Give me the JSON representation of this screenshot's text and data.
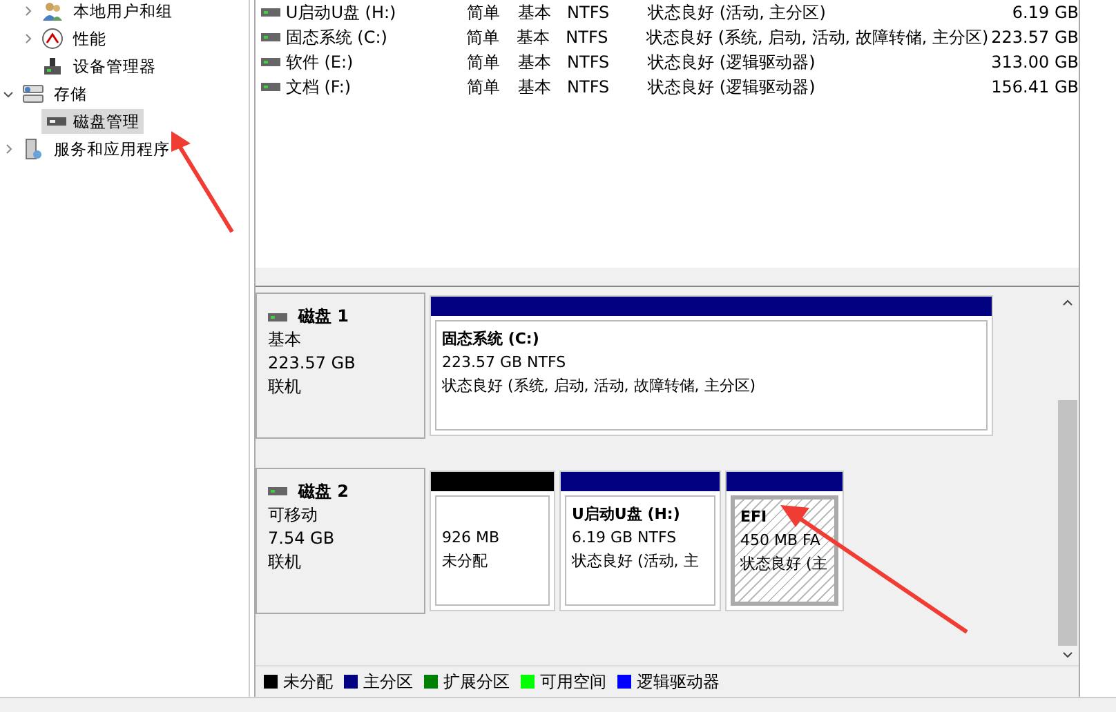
{
  "tree": {
    "items": [
      {
        "label": "本地用户和组",
        "kind": "folder",
        "expanded": false,
        "selected": false
      },
      {
        "label": "性能",
        "kind": "folder",
        "expanded": false,
        "selected": false
      },
      {
        "label": "设备管理器",
        "kind": "leaf",
        "selected": false
      },
      {
        "label": "存储",
        "kind": "folder",
        "expanded": true,
        "selected": false,
        "children": [
          {
            "label": "磁盘管理",
            "selected": true
          }
        ]
      },
      {
        "label": "服务和应用程序",
        "kind": "folder",
        "expanded": false,
        "selected": false
      }
    ]
  },
  "volumes": [
    {
      "name": "U启动U盘 (H:)",
      "layout": "简单",
      "type": "基本",
      "fs": "NTFS",
      "status": "状态良好 (活动, 主分区)",
      "capacity": "6.19 GB"
    },
    {
      "name": "固态系统 (C:)",
      "layout": "简单",
      "type": "基本",
      "fs": "NTFS",
      "status": "状态良好 (系统, 启动, 活动, 故障转储, 主分区)",
      "capacity": "223.57 GB"
    },
    {
      "name": "软件 (E:)",
      "layout": "简单",
      "type": "基本",
      "fs": "NTFS",
      "status": "状态良好 (逻辑驱动器)",
      "capacity": "313.00 GB"
    },
    {
      "name": "文档 (F:)",
      "layout": "简单",
      "type": "基本",
      "fs": "NTFS",
      "status": "状态良好 (逻辑驱动器)",
      "capacity": "156.41 GB"
    }
  ],
  "disks": [
    {
      "name": "磁盘 1",
      "type": "基本",
      "size": "223.57 GB",
      "state": "联机",
      "partitions": [
        {
          "title": "固态系统  (C:)",
          "line1": "223.57 GB NTFS",
          "line2": "状态良好 (系统, 启动, 活动, 故障转储, 主分区)",
          "color": "#000080",
          "selected": false
        }
      ]
    },
    {
      "name": "磁盘 2",
      "type": "可移动",
      "size": "7.54 GB",
      "state": "联机",
      "partitions": [
        {
          "line1": "926 MB",
          "line2": "未分配",
          "color": "#000000",
          "selected": false
        },
        {
          "title": "U启动U盘  (H:)",
          "line1": "6.19 GB NTFS",
          "line2": "状态良好 (活动, 主",
          "color": "#000080",
          "selected": false
        },
        {
          "title": "EFI",
          "line1": "450 MB FA",
          "line2": "状态良好 (主",
          "color": "#000080",
          "selected": true
        }
      ]
    }
  ],
  "legend": [
    {
      "label": "未分配",
      "color": "#000000"
    },
    {
      "label": "主分区",
      "color": "#000080"
    },
    {
      "label": "扩展分区",
      "color": "#008000"
    },
    {
      "label": "可用空间",
      "color": "#00ff00"
    },
    {
      "label": "逻辑驱动器",
      "color": "#0000ff"
    }
  ]
}
